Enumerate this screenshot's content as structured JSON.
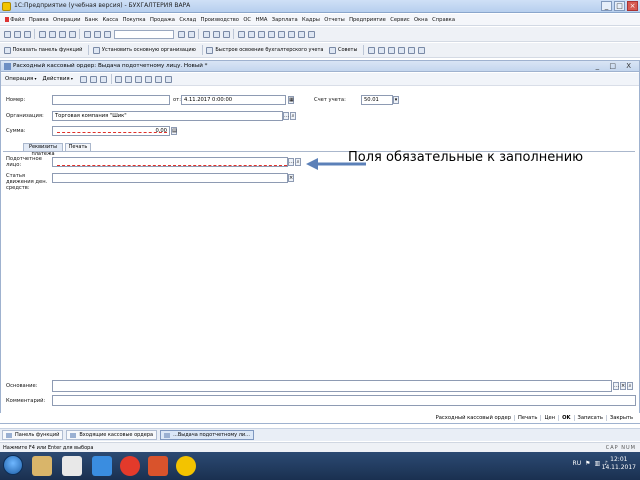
{
  "window": {
    "title": "1С:Предприятие (учебная версия) - БУХГАЛТЕРИЯ ВАРА"
  },
  "menu": [
    "Файл",
    "Правка",
    "Операции",
    "Банк",
    "Касса",
    "Покупка",
    "Продажа",
    "Склад",
    "Производство",
    "ОС",
    "НМА",
    "Зарплата",
    "Кадры",
    "Отчеты",
    "Предприятие",
    "Сервис",
    "Окна",
    "Справка"
  ],
  "toolbar2": {
    "panel_label": "Показать панель функций",
    "info_label": "Установить основную организацию",
    "manual_label": "Быстрое освоение бухгалтерского учета",
    "advice_label": "Советы"
  },
  "document": {
    "title": "Расходный кассовый ордер: Выдача подотчетному лицу. Новый *",
    "controls": "_ □ X",
    "formbar": {
      "operation": "Операция",
      "actions": "Действия"
    },
    "fields": {
      "number_label": "Номер:",
      "date_from_label": "от:",
      "date_value": "4.11.2017 0:00:00",
      "account_label": "Счет учета:",
      "account_value": "50.01",
      "org_label": "Организация:",
      "org_value": "Торговая компания \"Шик\"",
      "amount_label": "Сумма:",
      "amount_value": "0,00",
      "person_label": "Подотчетное лицо:",
      "cash_item_label": "Статья движения ден. средств:",
      "basis_label": "Основание:",
      "comment_label": "Комментарий:"
    },
    "tabs": [
      "Реквизиты платежа",
      "Печать"
    ],
    "actions": [
      "Расходный кассовый ордер",
      "Печать",
      "Цен",
      "OK",
      "Записать",
      "Закрыть"
    ]
  },
  "annotation": {
    "text": "Поля обязательные к заполнению"
  },
  "window_tabs": [
    "Панель функций",
    "Входящие кассовые ордера",
    "...Выдача подотчетному ли..."
  ],
  "statusbar": {
    "hint": "Нажмите F4 или Enter для выбора",
    "mode": "CAP NUM"
  },
  "taskbar": {
    "tray": "RU",
    "time": "12:01",
    "date": "14.11.2017"
  },
  "colors": {
    "required_dash": "#e0302a",
    "titlebar": "#c4d6ee",
    "taskbar": "#1a3050"
  }
}
